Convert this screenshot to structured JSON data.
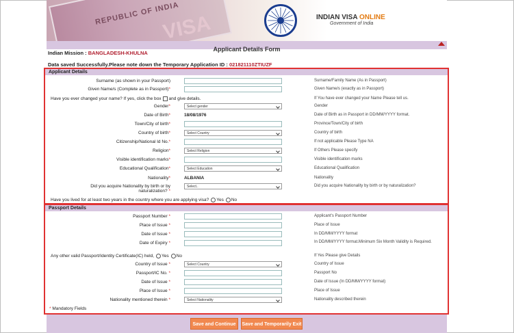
{
  "banner": {
    "passport_text": "REPUBLIC OF INDIA",
    "visa_text": "VISA",
    "brand_title_a": "INDIAN VISA ",
    "brand_title_b": "ONLINE",
    "brand_sub": "Government of India"
  },
  "title": "Applicant Details Form",
  "mission": {
    "label": "Indian Mission : ",
    "value": "BANGLADESH-KHULNA"
  },
  "saved": {
    "label": "Data saved Successfully.Please note down the Temporary Application ID : ",
    "value": "021821110ZTIUZF"
  },
  "applicant": {
    "heading": "Applicant Details",
    "rows": [
      {
        "label": "Surname (as shown in your Passport)",
        "req": "",
        "hint": "Surname/Family Name (As in Passport)"
      },
      {
        "label": "Given Name/s (Complete as in Passport)",
        "req": "*",
        "hint": "Given Name/s (exactly as in Passport)"
      },
      {
        "label": "Have you ever changed your name? If yes, click the box",
        "suffix": "and give details.",
        "hint": "If You have ever changed your Name Please tell us."
      },
      {
        "label": "Gender",
        "req": "*",
        "select": "Select gender",
        "hint": "Gender"
      },
      {
        "label": "Date of Birth",
        "req": "*",
        "value": "18/08/1976",
        "hint": "Date of Birth as in Passport in DD/MM/YYYY format."
      },
      {
        "label": "Town/City of birth",
        "req": "*",
        "hint": "Province/Town/City of birth"
      },
      {
        "label": "Country of birth",
        "req": "*",
        "select": "Select Country",
        "hint": "Country of birth"
      },
      {
        "label": "Citizenship/National Id No.",
        "req": "*",
        "hint": "If not applicable Please Type NA"
      },
      {
        "label": "Religion",
        "req": "*",
        "select": "Select Religion",
        "hint": "If Others  Please specify"
      },
      {
        "label": "Visible identification marks",
        "req": "*",
        "hint": "Visible identification marks"
      },
      {
        "label": "Educational Qualification",
        "req": "*",
        "select": "Select Education",
        "hint": "Educational Qualification"
      },
      {
        "label": "Nationality",
        "req": "*",
        "value": "ALBANIA",
        "hint": "Nationality"
      },
      {
        "label": "Did you acquire Nationality by birth or by",
        "label2": "naturalization?",
        "req": "*",
        "select": "Select..",
        "hint": "Did you acquire Nationality by birth or by naturalization?"
      },
      {
        "label": "Have you lived for at least two years in the country where you are applying visa?",
        "opt_yes": "Yes",
        "opt_no": "No"
      }
    ]
  },
  "passport": {
    "heading": "Passport Details",
    "rows": [
      {
        "label": "Passport Number",
        "req": "*",
        "hint": "Applicant's Passport Number"
      },
      {
        "label": "Place of Issue",
        "req": "*",
        "hint": "Place of Issue"
      },
      {
        "label": "Date of Issue",
        "req": "*",
        "hint": "In DD/MM/YYYY format"
      },
      {
        "label": "Date of Expiry",
        "req": "*",
        "hint": "In DD/MM/YYYY format.Minimum Six Month Validity is Required."
      },
      {
        "label": "Any other valid Passport/Identity Certificate(IC) held,",
        "opt_yes": "Yes",
        "opt_no": "No",
        "hint": "If Yes Please give Details"
      },
      {
        "label": "Country of Issue",
        "req": "*",
        "select": "Select Country",
        "hint": "Country of Issue"
      },
      {
        "label": "Passport/IC No.",
        "req": "*",
        "hint": "Passport No"
      },
      {
        "label": "Date of Issue",
        "req": "*",
        "hint": "Date of Issue (In DD/MM/YYYY format)"
      },
      {
        "label": "Place of Issue",
        "req": "*",
        "hint": "Place of Issue"
      },
      {
        "label": "Nationality mentioned therein",
        "req": "*",
        "select": "Select Nationality",
        "hint": "Nationality described therein"
      }
    ],
    "mandatory": " Mandatory Fields",
    "mandatory_star": "*"
  },
  "buttons": {
    "continue": "Save and Continue",
    "exit": "Save and Temporarily Exit"
  },
  "colors": {
    "accent": "#d8c6e0",
    "required": "#e03131",
    "button": "#f1884f"
  }
}
